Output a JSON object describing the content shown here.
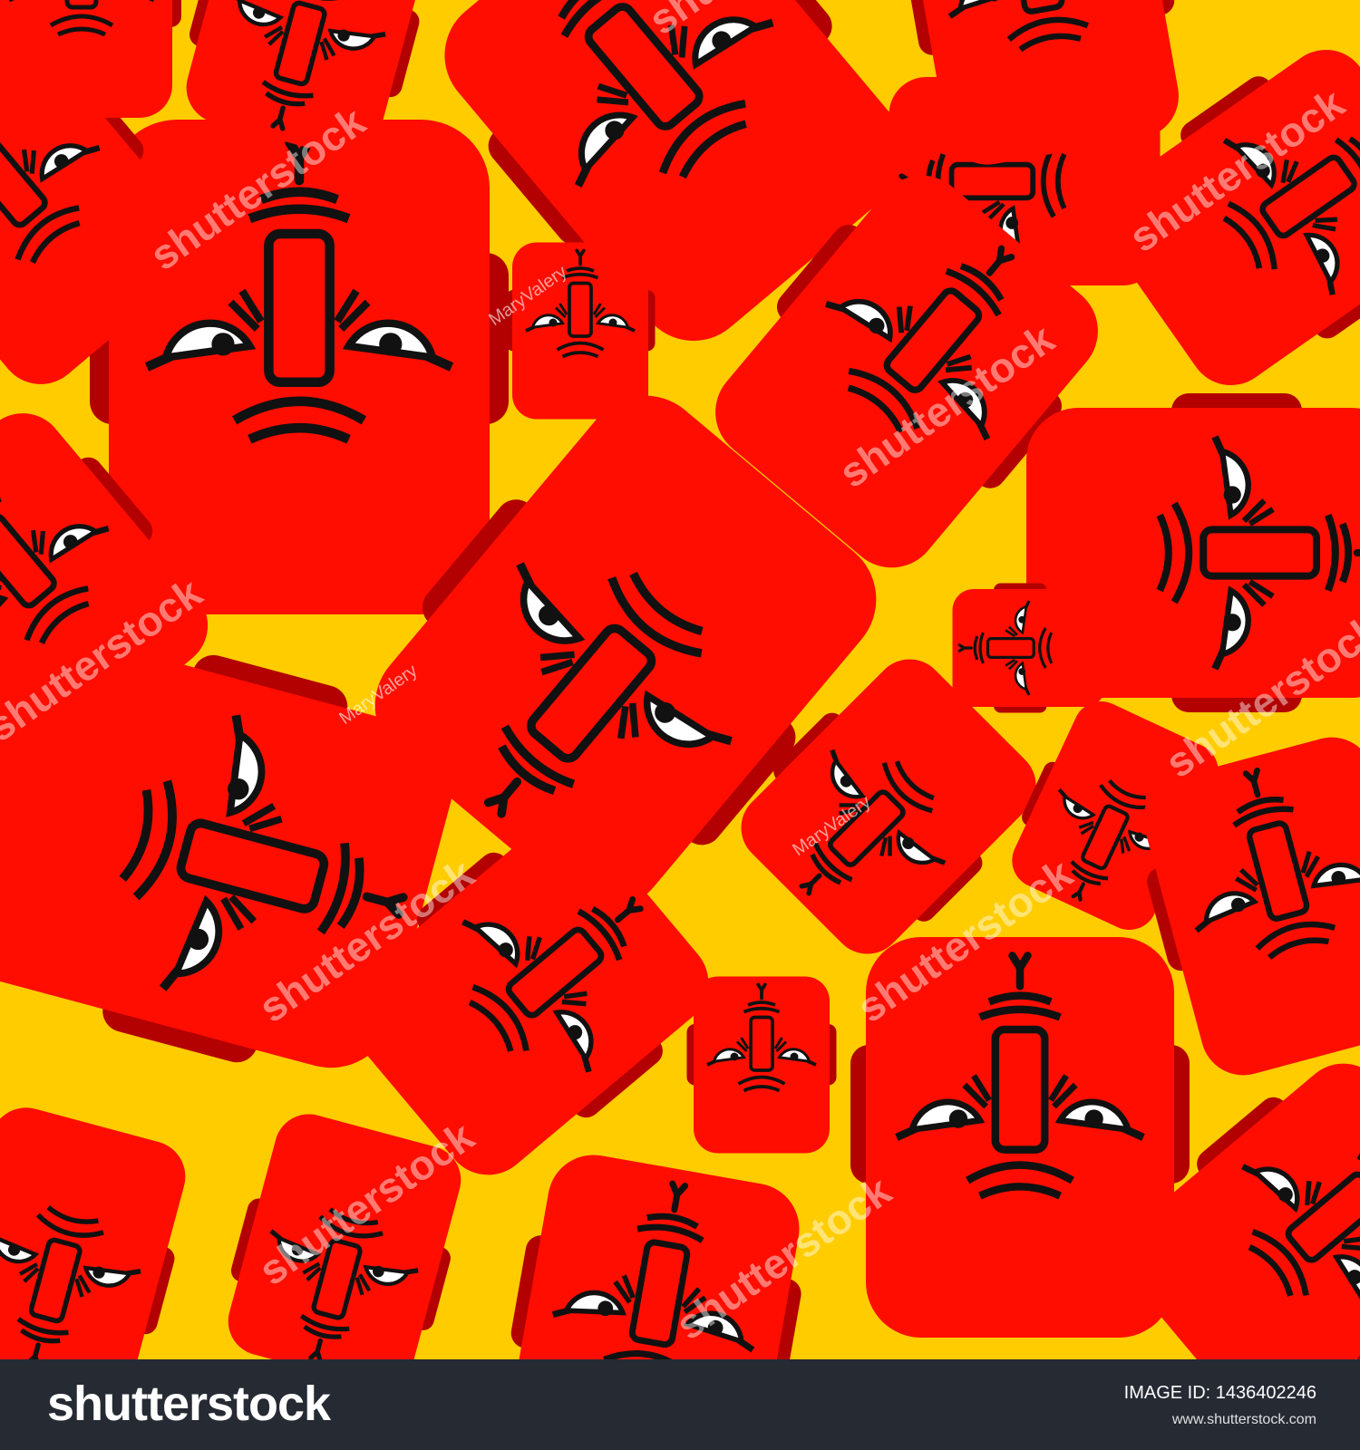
{
  "colors": {
    "background": "#ffcc00",
    "face": "#ff0d00",
    "ear": "#b30000",
    "line": "#111111",
    "eye_white": "#ffffff",
    "footer": "#262a33"
  },
  "pattern": {
    "motif": "angry red square face",
    "watermark_brand": "shutterstock",
    "watermark_author": "MaryValery"
  },
  "footer": {
    "logo": "shutterstock",
    "image_id": "IMAGE ID: 1436402246",
    "url": "www.shutterstock.com"
  }
}
